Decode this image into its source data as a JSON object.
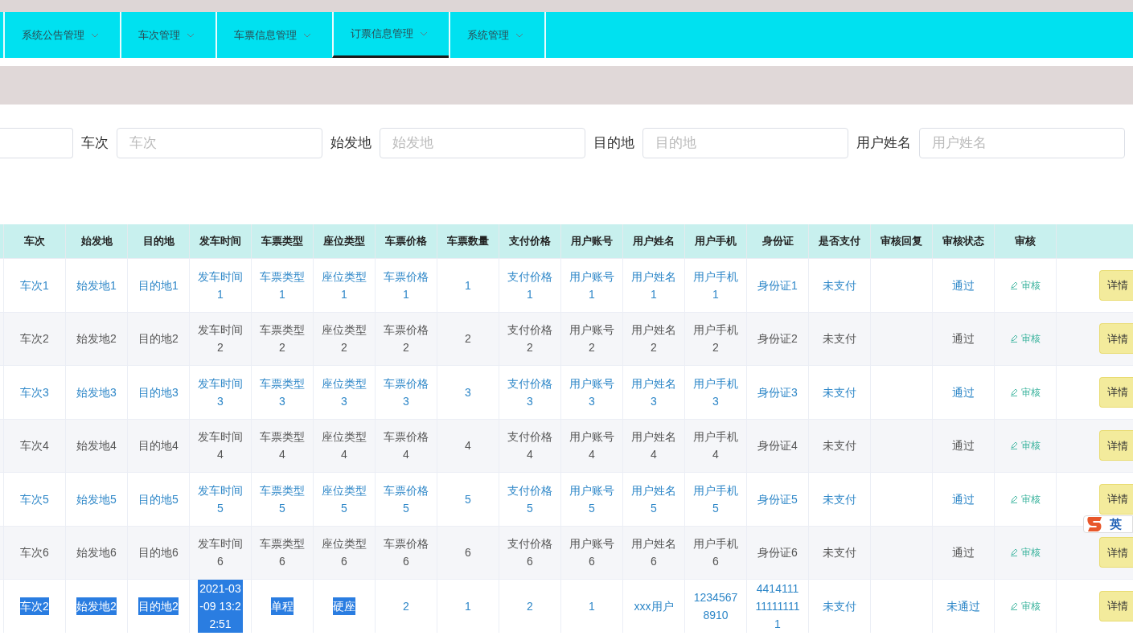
{
  "nav": {
    "items": [
      {
        "label": "系统公告管理",
        "selected": false
      },
      {
        "label": "车次管理",
        "selected": false
      },
      {
        "label": "车票信息管理",
        "selected": false
      },
      {
        "label": "订票信息管理",
        "selected": true
      },
      {
        "label": "系统管理",
        "selected": false
      }
    ]
  },
  "search": {
    "fields": [
      {
        "placeholder": "车次",
        "label": "车次"
      },
      {
        "placeholder": "始发地",
        "label": "始发地"
      },
      {
        "placeholder": "目的地",
        "label": "目的地"
      },
      {
        "placeholder": "用户姓名",
        "label": "用户姓名"
      }
    ]
  },
  "table": {
    "columns": [
      "车次",
      "始发地",
      "目的地",
      "发车时间",
      "车票类型",
      "座位类型",
      "车票价格",
      "车票数量",
      "支付价格",
      "用户账号",
      "用户姓名",
      "用户手机",
      "身份证",
      "是否支付",
      "审核回复",
      "审核状态",
      "审核"
    ],
    "rows": [
      {
        "kind": "link",
        "review": "审核",
        "detail": "详情",
        "cells": [
          {
            "text": "车次1",
            "highlighted": false
          },
          {
            "text": "始发地1",
            "highlighted": false
          },
          {
            "text": "目的地1",
            "highlighted": false
          },
          {
            "text": "发车时间1",
            "highlighted": false
          },
          {
            "text": "车票类型1",
            "highlighted": false
          },
          {
            "text": "座位类型1",
            "highlighted": false
          },
          {
            "text": "车票价格1",
            "highlighted": false
          },
          {
            "text": "1",
            "highlighted": false
          },
          {
            "text": "支付价格1",
            "highlighted": false
          },
          {
            "text": "用户账号1",
            "highlighted": false
          },
          {
            "text": "用户姓名1",
            "highlighted": false
          },
          {
            "text": "用户手机1",
            "highlighted": false
          },
          {
            "text": "身份证1",
            "highlighted": false
          },
          {
            "text": "未支付",
            "highlighted": false
          },
          {
            "highlighted": false
          },
          {
            "text": "通过",
            "highlighted": false
          }
        ]
      },
      {
        "kind": "plain",
        "review": "审核",
        "detail": "详情",
        "cells": [
          {
            "text": "车次2",
            "highlighted": false
          },
          {
            "text": "始发地2",
            "highlighted": false
          },
          {
            "text": "目的地2",
            "highlighted": false
          },
          {
            "text": "发车时间2",
            "highlighted": false
          },
          {
            "text": "车票类型2",
            "highlighted": false
          },
          {
            "text": "座位类型2",
            "highlighted": false
          },
          {
            "text": "车票价格2",
            "highlighted": false
          },
          {
            "text": "2",
            "highlighted": false
          },
          {
            "text": "支付价格2",
            "highlighted": false
          },
          {
            "text": "用户账号2",
            "highlighted": false
          },
          {
            "text": "用户姓名2",
            "highlighted": false
          },
          {
            "text": "用户手机2",
            "highlighted": false
          },
          {
            "text": "身份证2",
            "highlighted": false
          },
          {
            "text": "未支付",
            "highlighted": false
          },
          {
            "highlighted": false
          },
          {
            "text": "通过",
            "highlighted": false
          }
        ]
      },
      {
        "kind": "link",
        "review": "审核",
        "detail": "详情",
        "cells": [
          {
            "text": "车次3",
            "highlighted": false
          },
          {
            "text": "始发地3",
            "highlighted": false
          },
          {
            "text": "目的地3",
            "highlighted": false
          },
          {
            "text": "发车时间3",
            "highlighted": false
          },
          {
            "text": "车票类型3",
            "highlighted": false
          },
          {
            "text": "座位类型3",
            "highlighted": false
          },
          {
            "text": "车票价格3",
            "highlighted": false
          },
          {
            "text": "3",
            "highlighted": false
          },
          {
            "text": "支付价格3",
            "highlighted": false
          },
          {
            "text": "用户账号3",
            "highlighted": false
          },
          {
            "text": "用户姓名3",
            "highlighted": false
          },
          {
            "text": "用户手机3",
            "highlighted": false
          },
          {
            "text": "身份证3",
            "highlighted": false
          },
          {
            "text": "未支付",
            "highlighted": false
          },
          {
            "highlighted": false
          },
          {
            "text": "通过",
            "highlighted": false
          }
        ]
      },
      {
        "kind": "plain",
        "review": "审核",
        "detail": "详情",
        "cells": [
          {
            "text": "车次4",
            "highlighted": false
          },
          {
            "text": "始发地4",
            "highlighted": false
          },
          {
            "text": "目的地4",
            "highlighted": false
          },
          {
            "text": "发车时间4",
            "highlighted": false
          },
          {
            "text": "车票类型4",
            "highlighted": false
          },
          {
            "text": "座位类型4",
            "highlighted": false
          },
          {
            "text": "车票价格4",
            "highlighted": false
          },
          {
            "text": "4",
            "highlighted": false
          },
          {
            "text": "支付价格4",
            "highlighted": false
          },
          {
            "text": "用户账号4",
            "highlighted": false
          },
          {
            "text": "用户姓名4",
            "highlighted": false
          },
          {
            "text": "用户手机4",
            "highlighted": false
          },
          {
            "text": "身份证4",
            "highlighted": false
          },
          {
            "text": "未支付",
            "highlighted": false
          },
          {
            "highlighted": false
          },
          {
            "text": "通过",
            "highlighted": false
          }
        ]
      },
      {
        "kind": "link",
        "review": "审核",
        "detail": "详情",
        "cells": [
          {
            "text": "车次5",
            "highlighted": false
          },
          {
            "text": "始发地5",
            "highlighted": false
          },
          {
            "text": "目的地5",
            "highlighted": false
          },
          {
            "text": "发车时间5",
            "highlighted": false
          },
          {
            "text": "车票类型5",
            "highlighted": false
          },
          {
            "text": "座位类型5",
            "highlighted": false
          },
          {
            "text": "车票价格5",
            "highlighted": false
          },
          {
            "text": "5",
            "highlighted": false
          },
          {
            "text": "支付价格5",
            "highlighted": false
          },
          {
            "text": "用户账号5",
            "highlighted": false
          },
          {
            "text": "用户姓名5",
            "highlighted": false
          },
          {
            "text": "用户手机5",
            "highlighted": false
          },
          {
            "text": "身份证5",
            "highlighted": false
          },
          {
            "text": "未支付",
            "highlighted": false
          },
          {
            "highlighted": false
          },
          {
            "text": "通过",
            "highlighted": false
          }
        ]
      },
      {
        "kind": "plain",
        "review": "审核",
        "detail": "详情",
        "cells": [
          {
            "text": "车次6",
            "highlighted": false
          },
          {
            "text": "始发地6",
            "highlighted": false
          },
          {
            "text": "目的地6",
            "highlighted": false
          },
          {
            "text": "发车时间6",
            "highlighted": false
          },
          {
            "text": "车票类型6",
            "highlighted": false
          },
          {
            "text": "座位类型6",
            "highlighted": false
          },
          {
            "text": "车票价格6",
            "highlighted": false
          },
          {
            "text": "6",
            "highlighted": false
          },
          {
            "text": "支付价格6",
            "highlighted": false
          },
          {
            "text": "用户账号6",
            "highlighted": false
          },
          {
            "text": "用户姓名6",
            "highlighted": false
          },
          {
            "text": "用户手机6",
            "highlighted": false
          },
          {
            "text": "身份证6",
            "highlighted": false
          },
          {
            "text": "未支付",
            "highlighted": false
          },
          {
            "highlighted": false
          },
          {
            "text": "通过",
            "highlighted": false
          }
        ]
      },
      {
        "kind": "link",
        "review": "审核",
        "detail": "详情",
        "cells": [
          {
            "text": "车次2",
            "highlighted": true
          },
          {
            "text": "始发地2",
            "highlighted": true
          },
          {
            "text": "目的地2",
            "highlighted": true
          },
          {
            "text": "2021-03-09 13:22:51",
            "highlighted": true
          },
          {
            "text": "单程",
            "highlighted": true
          },
          {
            "text": "硬座",
            "highlighted": true
          },
          {
            "text": "2",
            "highlighted": false
          },
          {
            "text": "1",
            "highlighted": false
          },
          {
            "text": "2",
            "highlighted": false
          },
          {
            "text": "1",
            "highlighted": false
          },
          {
            "text": "xxx用户",
            "highlighted": false
          },
          {
            "text": "12345678910",
            "highlighted": false
          },
          {
            "text": "4414111111111111",
            "highlighted": false
          },
          {
            "text": "未支付",
            "highlighted": false
          },
          {
            "highlighted": false
          },
          {
            "text": "未通过",
            "highlighted": false
          }
        ]
      }
    ]
  },
  "ime_indicator": {
    "label": "英"
  }
}
